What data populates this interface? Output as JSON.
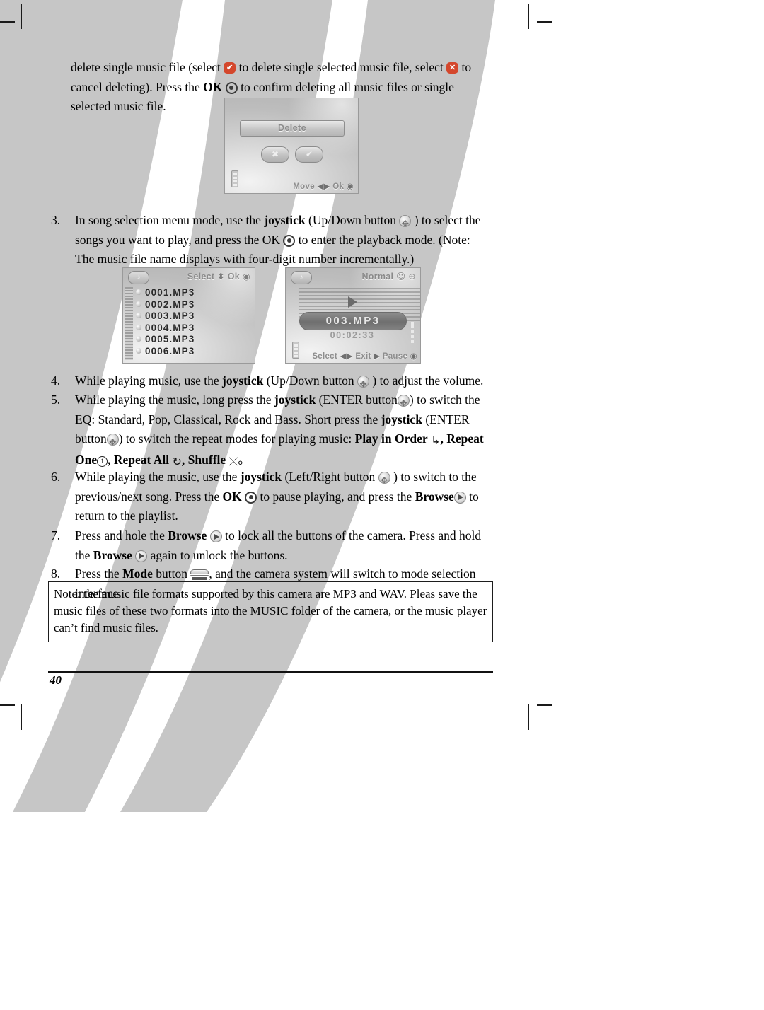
{
  "document": {
    "page_number": "40",
    "intro": {
      "line1_a": "delete single music file (select",
      "line1_b": "to delete single selected music file, select",
      "line1_c": "to cancel",
      "line2_a": "deleting). Press the",
      "line2_ok": "OK",
      "line2_b": "to confirm deleting all music files or single selected music file."
    },
    "steps": [
      {
        "number": "3.",
        "seg_a": "In song selection menu mode, use the",
        "bold_a": "joystick",
        "seg_b": "(Up/Down button",
        "seg_c": ") to select the songs you want to play, and press the OK",
        "seg_d": "to enter the playback mode. (Note: The music file name displays with four-digit number incrementally.)"
      },
      {
        "number": "4.",
        "seg_a": "While playing music, use the",
        "bold_a": "joystick",
        "seg_b": "(Up/Down button",
        "seg_c": ") to adjust the volume."
      },
      {
        "number": "5.",
        "seg_a": "While playing the music, long press the",
        "bold_a": "joystick",
        "seg_b": "(ENTER button",
        "seg_c": ") to switch the EQ: Standard, Pop, Classical, Rock and Bass. Short press the",
        "bold_b": "joystick",
        "seg_d": "(ENTER button",
        "seg_e": ") to switch the repeat modes for playing music:",
        "mode_1": "Play in Order",
        "mode_2": ", Repeat One",
        "mode_3": ", Repeat All",
        "mode_4": ", Shuffle",
        "mode_end": "。"
      },
      {
        "number": "6.",
        "seg_a": "While playing the music, use the",
        "bold_a": "joystick",
        "seg_b": "(Left/Right button",
        "seg_c": ") to switch to the previous/next song. Press the",
        "bold_b": "OK",
        "seg_d": "to pause playing, and press the",
        "bold_c": "Browse",
        "seg_e": "to return to the playlist."
      },
      {
        "number": "7.",
        "seg_a": "Press and hole the",
        "bold_a": "Browse",
        "seg_b": "to lock all the buttons of the camera. Press and hold the",
        "bold_b": "Browse",
        "seg_c": "again to unlock the buttons."
      },
      {
        "number": "8.",
        "seg_a": "Press the",
        "bold_a": "Mode",
        "seg_b": "button",
        "seg_c": ", and the camera system will switch to mode selection interface."
      }
    ],
    "note": "Note: the music file formats supported by this camera are MP3 and WAV. Pleas save the music files of these two formats into the MUSIC folder of the camera, or the music player can’t find music files."
  },
  "screens": {
    "delete_dialog": {
      "title": "Delete",
      "cancel_glyph": "✖",
      "confirm_glyph": "✔",
      "footer_move": "Move",
      "footer_ok": "Ok"
    },
    "playlist": {
      "note_glyph": "♪",
      "label_select": "Select",
      "label_ok": "Ok",
      "songs": [
        "0001.MP3",
        "0002.MP3",
        "0003.MP3",
        "0004.MP3",
        "0005.MP3",
        "0006.MP3"
      ]
    },
    "playback": {
      "note_glyph": "♪",
      "mode_label": "Normal",
      "track_name": "003.MP3",
      "elapsed": "00:02:33",
      "footer_select": "Select",
      "footer_exit": "Exit",
      "footer_pause": "Pause"
    }
  },
  "colors": {
    "accent_red": "#d4472c",
    "deco_gray": "#c6c6c6",
    "rule_black": "#111111"
  }
}
